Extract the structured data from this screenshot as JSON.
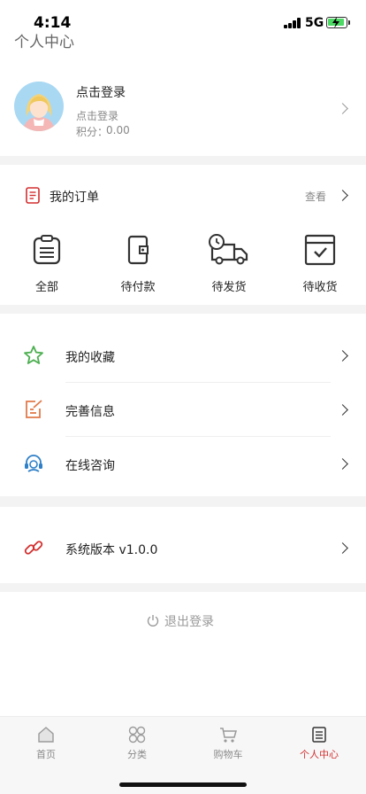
{
  "status_bar": {
    "time": "4:14",
    "network": "5G"
  },
  "header": {
    "title": "个人中心"
  },
  "profile": {
    "name": "点击登录",
    "subtitle": "点击登录",
    "points_label": "积分：",
    "points_value": "0.00"
  },
  "orders": {
    "title": "我的订单",
    "view_all": "查看",
    "items": [
      {
        "label": "全部",
        "icon": "clipboard-icon"
      },
      {
        "label": "待付款",
        "icon": "wallet-icon"
      },
      {
        "label": "待发货",
        "icon": "delivery-truck-icon"
      },
      {
        "label": "待收货",
        "icon": "received-box-icon"
      }
    ]
  },
  "menu": [
    {
      "label": "我的收藏",
      "icon": "star-icon",
      "color": "#4caf50"
    },
    {
      "label": "完善信息",
      "icon": "edit-icon",
      "color": "#e07a4a"
    },
    {
      "label": "在线咨询",
      "icon": "headset-icon",
      "color": "#2f80c8"
    }
  ],
  "version": {
    "label": "系统版本 v1.0.0",
    "icon": "link-icon",
    "color": "#d32f2f"
  },
  "logout": {
    "label": "退出登录",
    "icon": "power-icon"
  },
  "tabbar": [
    {
      "label": "首页",
      "icon": "home-icon",
      "active": false
    },
    {
      "label": "分类",
      "icon": "grid-icon",
      "active": false
    },
    {
      "label": "购物车",
      "icon": "cart-icon",
      "active": false
    },
    {
      "label": "个人中心",
      "icon": "profile-doc-icon",
      "active": true
    }
  ],
  "colors": {
    "accent": "#d32f2f",
    "background": "#f3f3f3",
    "card": "#ffffff"
  }
}
